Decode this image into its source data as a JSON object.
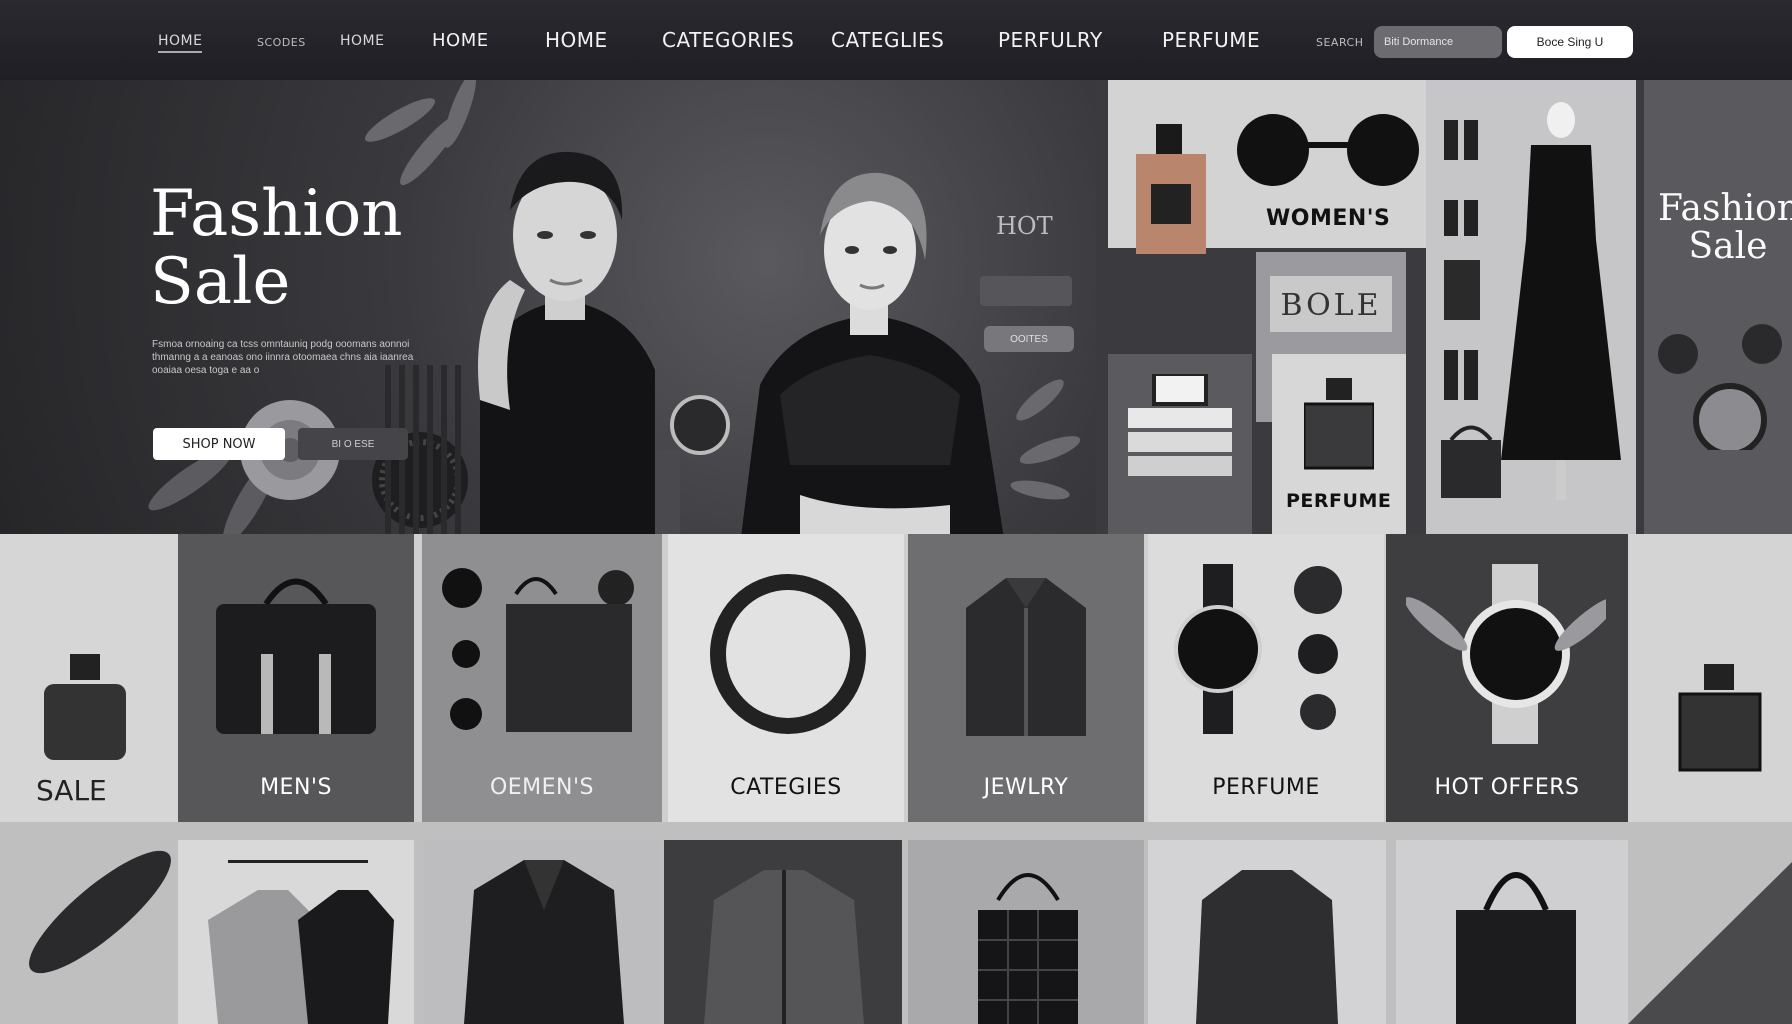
{
  "nav": {
    "items": [
      "HOME",
      "SCODES",
      "HOME",
      "HOME",
      "HOME",
      "CATEGORIES",
      "CATEGLIES",
      "PERFULRY",
      "PERFUME",
      "SEARCH"
    ],
    "search_placeholder": "Biti Dormance",
    "cta_label": "Boce Sing  U"
  },
  "hero": {
    "title_line1": "Fashion",
    "title_line2": "Sale",
    "description": "Fsmoa ornoaing ca tcss omntauniq podg ooomans aonnoi thmanng a a eanoas ono iinnra otoomaea chns aia iaanrea ooaiaa oesa toga e aa o",
    "shop_button": "SHOP NOW",
    "secondary_button": "BI O ESE",
    "hot_label": "HOT",
    "hot_pill": "OOITES"
  },
  "collage": {
    "womens_label": "WOMEN'S",
    "bole_label": "BOLE",
    "perfume_label": "PERFUME",
    "side_title_line1": "Fashion",
    "side_title_line2": "Sale"
  },
  "categories": {
    "sale_label": "SALE",
    "tiles": [
      {
        "label": "MEN'S"
      },
      {
        "label": "OEMEN'S"
      },
      {
        "label": "CATEGIES"
      },
      {
        "label": "JEWLRY"
      },
      {
        "label": "PERFUME"
      },
      {
        "label": "HOT OFFERS"
      }
    ]
  },
  "colors": {
    "nav_bg": "#1f1f25",
    "accent": "#ffffff",
    "tile_dark": "#555558",
    "tile_light": "#d9d9d9"
  }
}
